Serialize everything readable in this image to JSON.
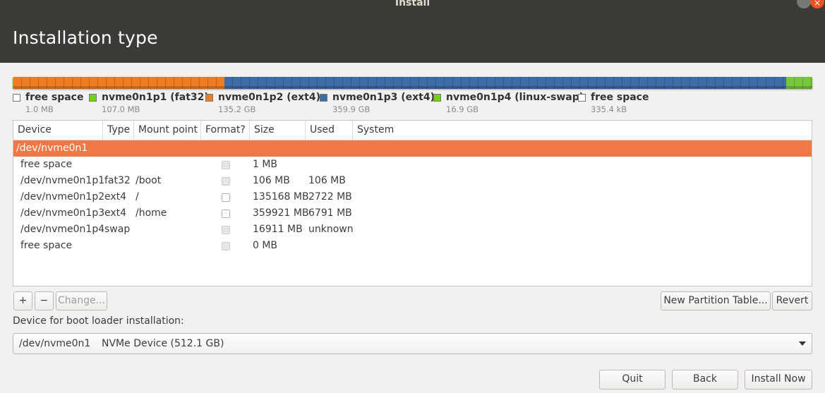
{
  "window": {
    "title": "Install",
    "close_glyph": "×"
  },
  "page_title": "Installation type",
  "partition_bar": [
    {
      "name": "free-space-1",
      "fraction": 0.0,
      "color": "#ffffff"
    },
    {
      "name": "nvme0n1p1",
      "fraction": 0.0005,
      "color": "#73d216"
    },
    {
      "name": "nvme0n1p2",
      "fraction": 0.264,
      "color": "#f07c22"
    },
    {
      "name": "nvme0n1p3",
      "fraction": 0.7028,
      "color": "#3d6ba6"
    },
    {
      "name": "nvme0n1p4",
      "fraction": 0.033,
      "color": "#78c63b"
    }
  ],
  "legend": [
    {
      "name": "free space",
      "size": "1.0 MB",
      "color": "#ffffff"
    },
    {
      "name": "nvme0n1p1 (fat32)",
      "size": "107.0 MB",
      "color": "#73d216"
    },
    {
      "name": "nvme0n1p2 (ext4)",
      "size": "135.2 GB",
      "color": "#f07c22"
    },
    {
      "name": "nvme0n1p3 (ext4)",
      "size": "359.9 GB",
      "color": "#3d6ba6"
    },
    {
      "name": "nvme0n1p4 (linux-swap)",
      "size": "16.9 GB",
      "color": "#73d216"
    },
    {
      "name": "free space",
      "size": "335.4 kB",
      "color": "#ffffff"
    }
  ],
  "table": {
    "columns": [
      "Device",
      "Type",
      "Mount point",
      "Format?",
      "Size",
      "Used",
      "System"
    ],
    "rows": [
      {
        "device": "/dev/nvme0n1",
        "type": "",
        "mount": "",
        "format": "none",
        "size": "",
        "used": "",
        "system": "",
        "selected": true,
        "indent": false
      },
      {
        "device": "free space",
        "type": "",
        "mount": "",
        "format": "disabled",
        "size": "1 MB",
        "used": "",
        "system": "",
        "selected": false,
        "indent": true
      },
      {
        "device": "/dev/nvme0n1p1",
        "type": "fat32",
        "mount": "/boot",
        "format": "disabled",
        "size": "106 MB",
        "used": "106 MB",
        "system": "",
        "selected": false,
        "indent": true
      },
      {
        "device": "/dev/nvme0n1p2",
        "type": "ext4",
        "mount": "/",
        "format": "enabled",
        "size": "135168 MB",
        "used": "2722 MB",
        "system": "",
        "selected": false,
        "indent": true
      },
      {
        "device": "/dev/nvme0n1p3",
        "type": "ext4",
        "mount": "/home",
        "format": "enabled",
        "size": "359921 MB",
        "used": "6791 MB",
        "system": "",
        "selected": false,
        "indent": true
      },
      {
        "device": "/dev/nvme0n1p4",
        "type": "swap",
        "mount": "",
        "format": "disabled",
        "size": "16911 MB",
        "used": "unknown",
        "system": "",
        "selected": false,
        "indent": true
      },
      {
        "device": "free space",
        "type": "",
        "mount": "",
        "format": "disabled",
        "size": "0 MB",
        "used": "",
        "system": "",
        "selected": false,
        "indent": true
      }
    ]
  },
  "toolbar": {
    "add_label": "+",
    "remove_label": "−",
    "change_label": "Change...",
    "new_table_label": "New Partition Table...",
    "revert_label": "Revert"
  },
  "bootloader": {
    "label": "Device for boot loader installation:",
    "device": "/dev/nvme0n1",
    "description": "NVMe Device (512.1 GB)"
  },
  "footer": {
    "quit_label": "Quit",
    "back_label": "Back",
    "install_label": "Install Now"
  }
}
